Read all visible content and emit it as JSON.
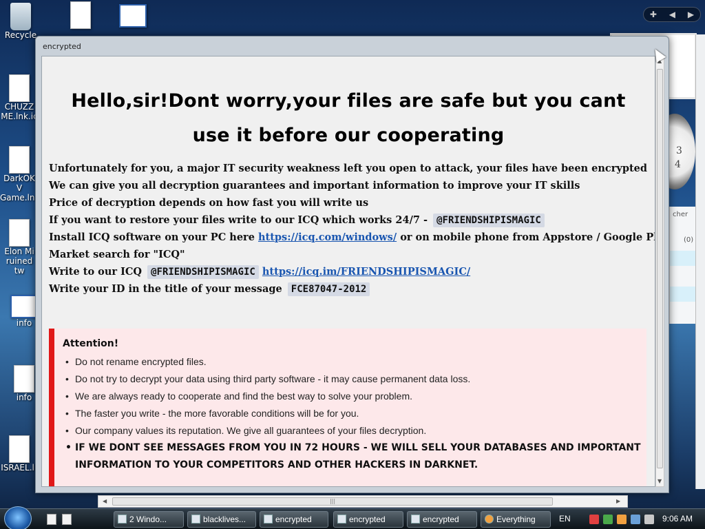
{
  "desktop": {
    "icons": [
      {
        "label": "Recycle",
        "glyph": "recycle-bin-icon"
      },
      {
        "label": "",
        "glyph": "document-icon"
      },
      {
        "label": "",
        "glyph": "window-icon"
      },
      {
        "label": "CHUZZ ME.lnk.ic",
        "glyph": "document-icon"
      },
      {
        "label": "DarkOK V Game.lnk",
        "glyph": "document-icon"
      },
      {
        "label": "Elon Mi ruined tw",
        "glyph": "document-icon"
      },
      {
        "label": "info",
        "glyph": "window-icon"
      },
      {
        "label": "info",
        "glyph": "document-icon"
      },
      {
        "label": "ISRAEL.lr",
        "glyph": "document-icon"
      }
    ],
    "side_panel_label": "cher",
    "side_panel_count": "(0)",
    "clock_numbers": [
      "3",
      "4"
    ]
  },
  "window": {
    "title": "encrypted",
    "heading": "Hello,sir!Dont worry,your files are safe but you cant use it before our cooperating",
    "lines": {
      "l1": "Unfortunately for you, a major IT security weakness left you open to attack, your files have been encrypted",
      "l2": "We can give you all decryption guarantees and important information to improve your IT skills",
      "l3": "Price of decryption depends on how fast you will write us",
      "l4_text": "If you want to restore your files write to our ICQ which works 24/7 -",
      "l4_chip": "@FRIENDSHIPISMAGIC",
      "l5_pre": "Install ICQ software on your PC here",
      "l5_link": "https://icq.com/windows/",
      "l5_post": "or on mobile phone from Appstore / Google Play",
      "l6": "Market search for \"ICQ\"",
      "l7_pre": "Write to our ICQ",
      "l7_chip": "@FRIENDSHIPISMAGIC",
      "l7_link": "https://icq.im/FRIENDSHIPISMAGIC/",
      "l8_pre": "Write your ID in the title of your message",
      "l8_chip": "FCE87047-2012"
    },
    "attention": {
      "title": "Attention!",
      "items": [
        "Do not rename encrypted files.",
        "Do not try to decrypt your data using third party software - it may cause permanent data loss.",
        "We are always ready to cooperate and find the best way to solve your problem.",
        "The faster you write - the more favorable conditions will be for you.",
        "Our company values its reputation. We give all guarantees of your files decryption.",
        "IF WE DONT SEE MESSAGES FROM YOU IN 72 HOURS - WE WILL SELL YOUR DATABASES AND IMPORTANT INFORMATION TO YOUR COMPETITORS AND OTHER HACKERS IN DARKNET."
      ]
    }
  },
  "taskbar": {
    "tasks": [
      "2 Windo...",
      "blacklives...",
      "encrypted",
      "encrypted",
      "encrypted",
      "Everything"
    ],
    "language": "EN",
    "time": "9:06 AM"
  },
  "colors": {
    "alert_red": "#e01818",
    "alert_bg": "#fde8ea",
    "link_blue": "#1a56b0",
    "chip_bg": "#d4d9e4"
  }
}
